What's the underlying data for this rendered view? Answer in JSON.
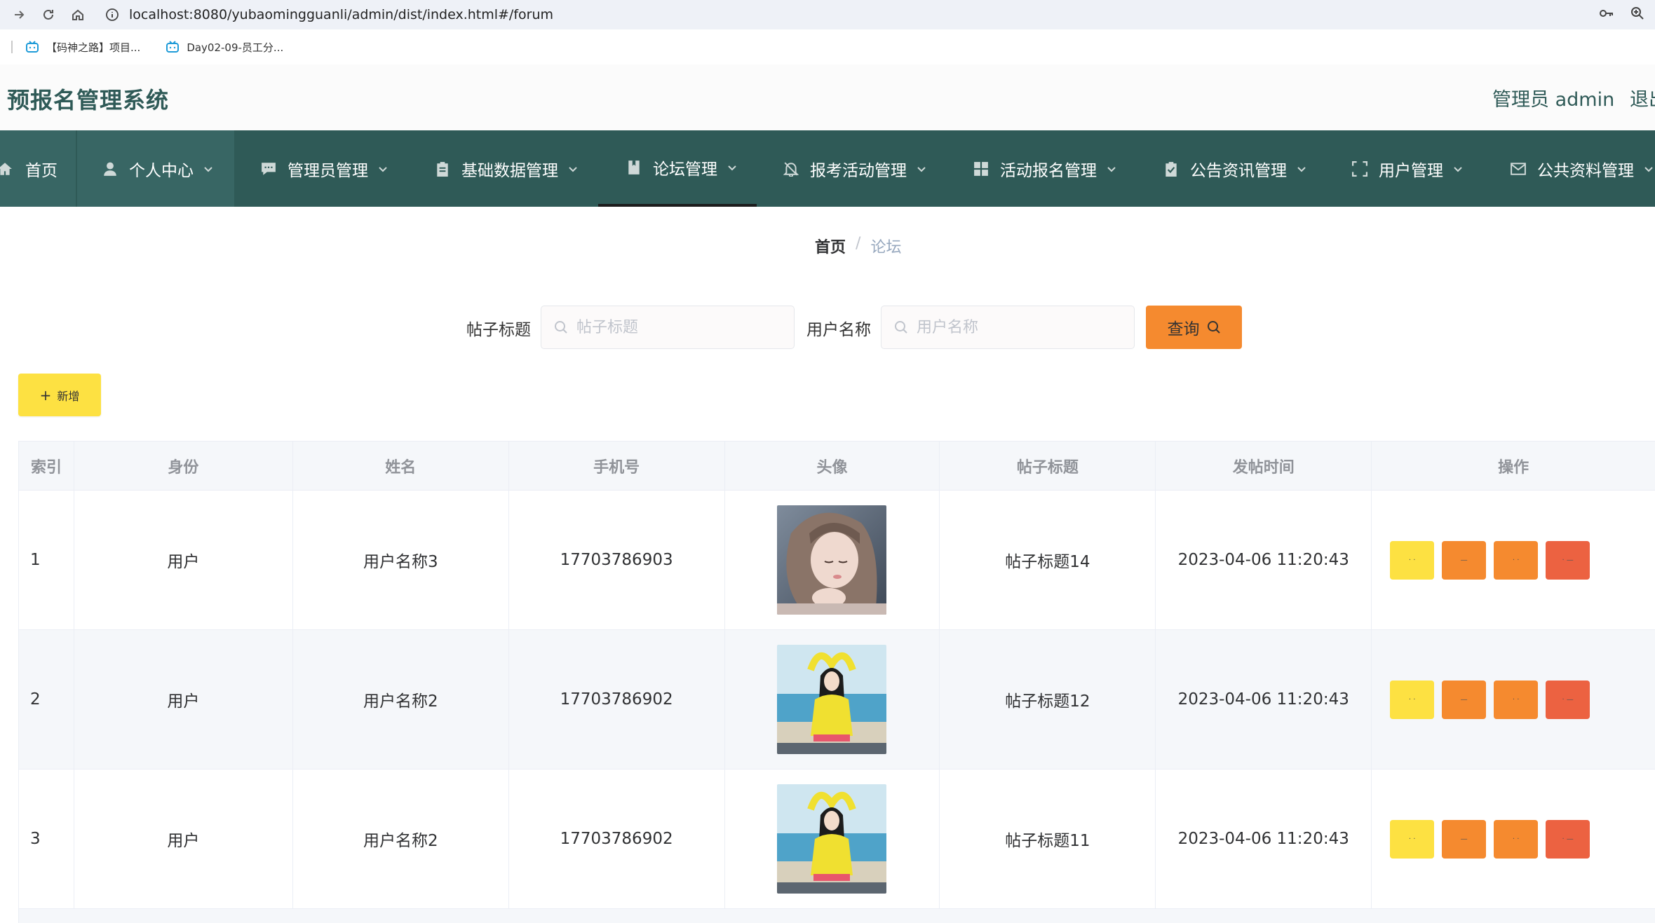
{
  "browser": {
    "url": "localhost:8080/yubaomingguanli/admin/dist/index.html#/forum",
    "bookmarks": [
      {
        "label": "【码神之路】项目..."
      },
      {
        "label": "Day02-09-员工分..."
      }
    ]
  },
  "header": {
    "title": "预报名管理系统",
    "admin": "管理员 admin",
    "logout": "退出"
  },
  "menu": {
    "items": [
      {
        "label": "首页",
        "icon": "home-icon"
      },
      {
        "label": "个人中心",
        "icon": "user-icon"
      },
      {
        "label": "管理员管理",
        "icon": "chat-icon"
      },
      {
        "label": "基础数据管理",
        "icon": "clipboard-icon"
      },
      {
        "label": "论坛管理",
        "icon": "book-icon"
      },
      {
        "label": "报考活动管理",
        "icon": "bell-icon"
      },
      {
        "label": "活动报名管理",
        "icon": "grid-icon"
      },
      {
        "label": "公告资讯管理",
        "icon": "checklist-icon"
      },
      {
        "label": "用户管理",
        "icon": "fullscreen-icon"
      },
      {
        "label": "公共资料管理",
        "icon": "mail-icon"
      }
    ]
  },
  "breadcrumb": {
    "home": "首页",
    "sep": "/",
    "current": "论坛"
  },
  "search": {
    "title_label": "帖子标题",
    "title_placeholder": "帖子标题",
    "user_label": "用户名称",
    "user_placeholder": "用户名称",
    "query_label": "查询"
  },
  "toolbar": {
    "add_label": "新增"
  },
  "table": {
    "headers": [
      "索引",
      "身份",
      "姓名",
      "手机号",
      "头像",
      "帖子标题",
      "发帖时间",
      "操作"
    ],
    "rows": [
      {
        "index": "1",
        "role": "用户",
        "name": "用户名称3",
        "phone": "17703786903",
        "avatar": "girl-portrait",
        "title": "帖子标题14",
        "time": "2023-04-06 11:20:43"
      },
      {
        "index": "2",
        "role": "用户",
        "name": "用户名称2",
        "phone": "17703786902",
        "avatar": "girl-beach",
        "title": "帖子标题12",
        "time": "2023-04-06 11:20:43"
      },
      {
        "index": "3",
        "role": "用户",
        "name": "用户名称2",
        "phone": "17703786902",
        "avatar": "girl-beach",
        "title": "帖子标题11",
        "time": "2023-04-06 11:20:43"
      }
    ],
    "op_colors": [
      "#fde142",
      "#f58a2f",
      "#f58a2f",
      "#ec6241"
    ]
  },
  "colors": {
    "theme": "#2f5a57",
    "accent_orange": "#f58a2f",
    "accent_yellow": "#fde142",
    "danger": "#ec6241"
  }
}
